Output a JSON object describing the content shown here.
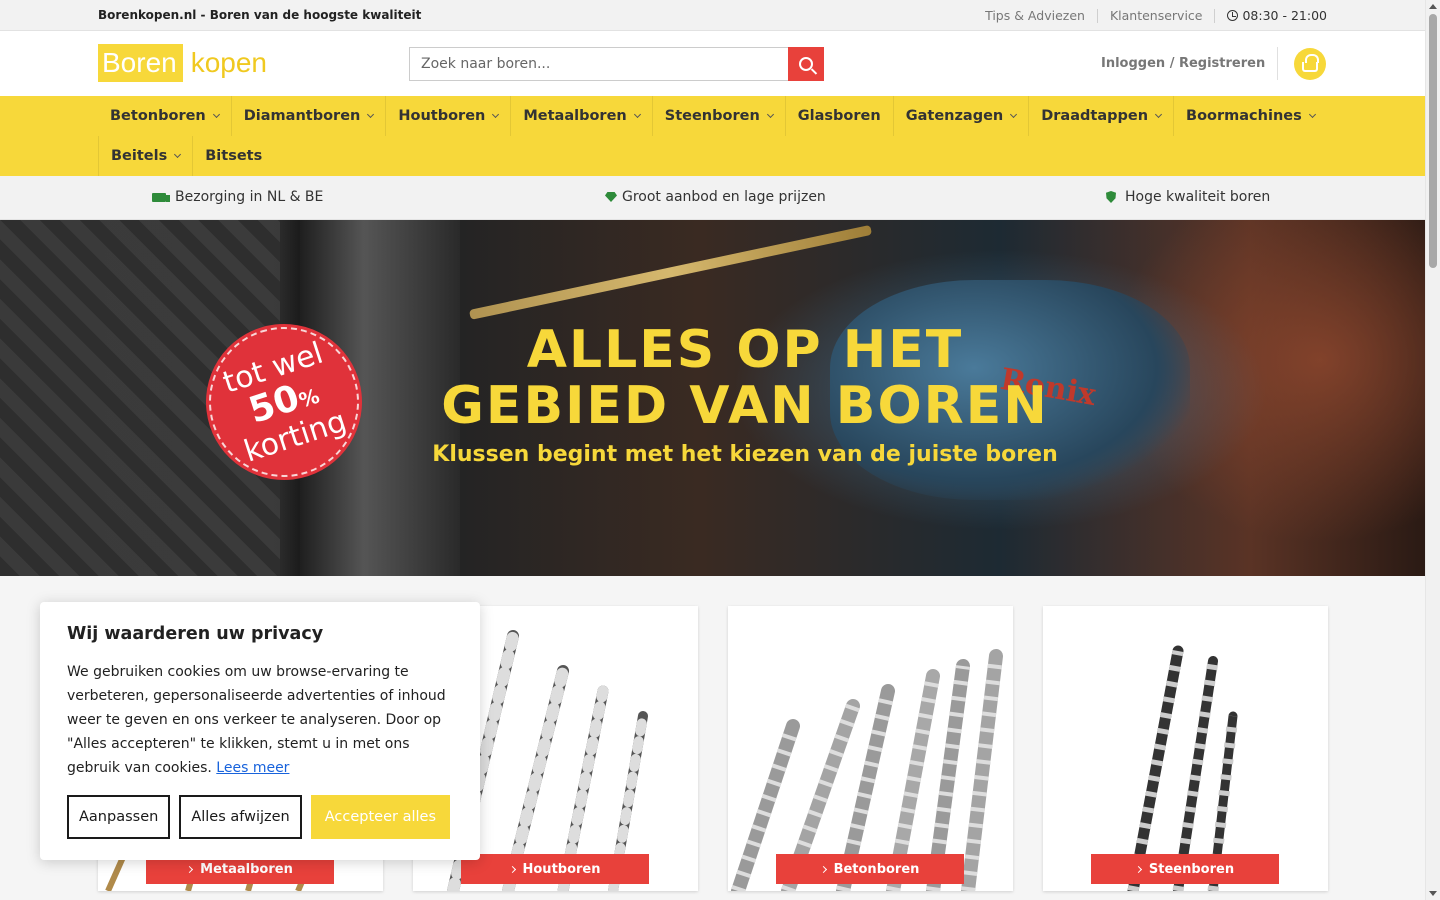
{
  "topbar": {
    "tagline": "Borenkopen.nl - Boren van de hoogste kwaliteit",
    "tips": "Tips & Adviezen",
    "service": "Klantenservice",
    "hours": "08:30 - 21:00"
  },
  "header": {
    "logo_part1": "Boren",
    "logo_part2": "kopen",
    "search_placeholder": "Zoek naar boren...",
    "login": "Inloggen / Registreren"
  },
  "nav": {
    "row1": [
      {
        "label": "Betonboren",
        "dropdown": true
      },
      {
        "label": "Diamantboren",
        "dropdown": true
      },
      {
        "label": "Houtboren",
        "dropdown": true
      },
      {
        "label": "Metaalboren",
        "dropdown": true
      },
      {
        "label": "Steenboren",
        "dropdown": true
      },
      {
        "label": "Glasboren",
        "dropdown": false
      },
      {
        "label": "Gatenzagen",
        "dropdown": true
      },
      {
        "label": "Draadtappen",
        "dropdown": true
      },
      {
        "label": "Boormachines",
        "dropdown": true
      }
    ],
    "row2": [
      {
        "label": "Beitels",
        "dropdown": true
      },
      {
        "label": "Bitsets",
        "dropdown": false
      }
    ]
  },
  "usp": {
    "delivery": "Bezorging in NL & BE",
    "range": "Groot aanbod en lage prijzen",
    "quality": "Hoge kwaliteit boren"
  },
  "hero": {
    "title_line1": "ALLES OP HET",
    "title_line2": "GEBIED VAN BOREN",
    "subtitle": "Klussen begint met het kiezen van de juiste boren",
    "badge_line1": "tot wel",
    "badge_number": "50",
    "badge_percent": "%",
    "badge_line3": "korting",
    "drill_brand": "Ronix"
  },
  "cards": [
    {
      "label": "Metaalboren"
    },
    {
      "label": "Houtboren"
    },
    {
      "label": "Betonboren"
    },
    {
      "label": "Steenboren"
    }
  ],
  "cookie": {
    "title": "Wij waarderen uw privacy",
    "body": "We gebruiken cookies om uw browse-ervaring te verbeteren, gepersonaliseerde advertenties of inhoud weer te geven en ons verkeer te analyseren. Door op \"Alles accepteren\" te klikken, stemt u in met ons gebruik van cookies.",
    "link": "Lees meer",
    "btn_customize": "Aanpassen",
    "btn_reject": "Alles afwijzen",
    "btn_accept": "Accepteer alles"
  },
  "colors": {
    "brand_yellow": "#f7d83a",
    "accent_red": "#e8413b",
    "usp_green": "#2e8b3a"
  }
}
